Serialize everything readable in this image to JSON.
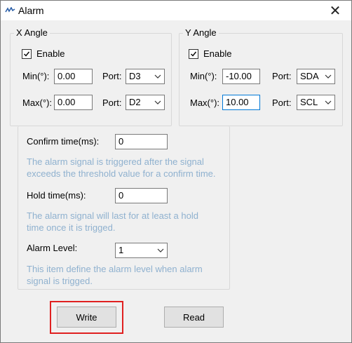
{
  "window": {
    "title": "Alarm",
    "close_glyph": "✕",
    "icon": "app-logo-icon"
  },
  "x_angle": {
    "legend": "X Angle",
    "enable_label": "Enable",
    "enabled": true,
    "min_label": "Min(°):",
    "min_value": "0.00",
    "max_label": "Max(°):",
    "max_value": "0.00",
    "min_port_label": "Port:",
    "min_port_value": "D3",
    "max_port_label": "Port:",
    "max_port_value": "D2"
  },
  "y_angle": {
    "legend": "Y Angle",
    "enable_label": "Enable",
    "enabled": true,
    "min_label": "Min(°):",
    "min_value": "-10.00",
    "max_label": "Max(°):",
    "max_value": "10.00",
    "min_port_label": "Port:",
    "min_port_value": "SDA",
    "max_port_label": "Port:",
    "max_port_value": "SCL"
  },
  "confirm": {
    "label": "Confirm time(ms):",
    "value": "0",
    "help_line1": "The alarm signal is triggered after the signal",
    "help_line2": "exceeds the threshold value for a confirm time."
  },
  "hold": {
    "label": "Hold time(ms):",
    "value": "0",
    "help_line1": "The alarm signal will last for at least a hold",
    "help_line2": "time once it is trigged."
  },
  "level": {
    "label": "Alarm Level:",
    "value": "1",
    "help_line1": "This item define the alarm level when alarm",
    "help_line2": "signal is trigged."
  },
  "buttons": {
    "write": "Write",
    "read": "Read"
  },
  "colors": {
    "help_text": "#8fb1cf",
    "highlight": "#e02020",
    "focus": "#0078d7"
  }
}
